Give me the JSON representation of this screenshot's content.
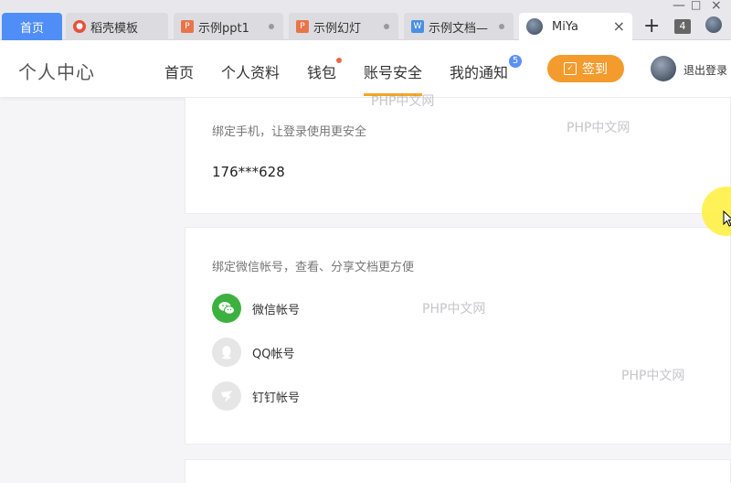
{
  "tabs": [
    {
      "label": "首页",
      "kind": "home"
    },
    {
      "label": "稻壳模板",
      "icon": "daoke-icon",
      "color": "#e8503a"
    },
    {
      "label": "示例ppt1",
      "icon": "ppt-icon",
      "color": "#e8754a"
    },
    {
      "label": "示例幻灯",
      "icon": "ppt-icon",
      "color": "#e8754a"
    },
    {
      "label": "示例文档—",
      "icon": "word-icon",
      "color": "#4a90e2"
    },
    {
      "label": "MiYa",
      "icon": "avatar-icon",
      "active": true
    }
  ],
  "tab_count": "4",
  "header": {
    "title": "个人中心",
    "nav": [
      "首页",
      "个人资料",
      "钱包",
      "账号安全",
      "我的通知"
    ],
    "notify_badge": "5",
    "signin_label": "签到",
    "logout_label": "退出登录"
  },
  "phone_card": {
    "hint": "绑定手机，让登录使用更安全",
    "phone": "176***628"
  },
  "social_card": {
    "hint": "绑定微信帐号，查看、分享文档更方便",
    "accounts": [
      {
        "label": "微信帐号",
        "icon": "wechat-icon"
      },
      {
        "label": "QQ帐号",
        "icon": "qq-icon"
      },
      {
        "label": "钉钉帐号",
        "icon": "dingtalk-icon"
      }
    ]
  },
  "watermark": "PHP中文网",
  "colors": {
    "accent": "#f39b2d",
    "home_tab": "#4f8ef7",
    "wechat": "#3db13f"
  }
}
